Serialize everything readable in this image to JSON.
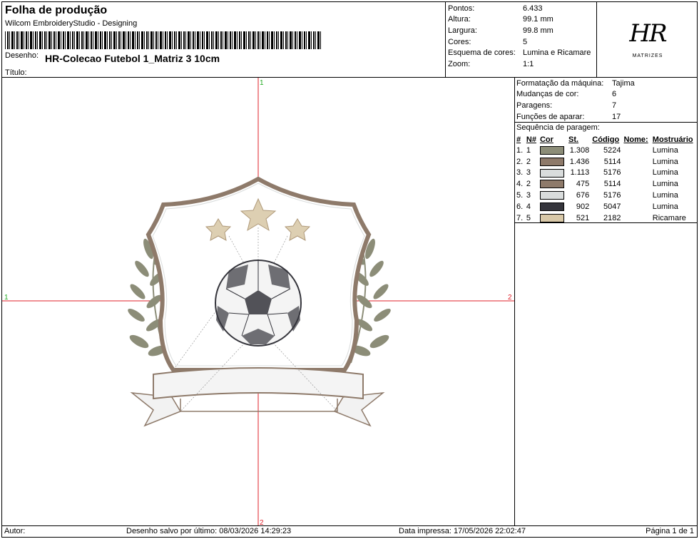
{
  "header": {
    "title": "Folha de produção",
    "subtitle": "Wilcom EmbroideryStudio - Designing",
    "design_label": "Desenho:",
    "design_value": "HR-Colecao Futebol 1_Matriz 3 10cm",
    "title_label": "Título:"
  },
  "stats": [
    {
      "label": "Pontos:",
      "value": "6.433"
    },
    {
      "label": "Altura:",
      "value": "99.1 mm"
    },
    {
      "label": "Largura:",
      "value": "99.8 mm"
    },
    {
      "label": "Cores:",
      "value": "5"
    },
    {
      "label": "Esquema de cores:",
      "value": "Lumina e Ricamare"
    },
    {
      "label": "Zoom:",
      "value": "1:1"
    }
  ],
  "logo": {
    "mark": "HR",
    "text": "MATRIZES"
  },
  "machine": [
    {
      "label": "Formatação da máquina:",
      "value": "Tajima"
    },
    {
      "label": "Mudanças de cor:",
      "value": "6"
    },
    {
      "label": "Paragens:",
      "value": "7"
    },
    {
      "label": "Funções de aparar:",
      "value": "17"
    }
  ],
  "sequence": {
    "title": "Sequência de paragem:",
    "headers": [
      "#",
      "N#",
      "Cor",
      "St.",
      "Código",
      "Nome:",
      "Mostruário"
    ],
    "rows": [
      {
        "idx": "1.",
        "n": "1",
        "color": "#8c8d78",
        "st": "1.308",
        "code": "5224",
        "name": "",
        "chart": "Lumina"
      },
      {
        "idx": "2.",
        "n": "2",
        "color": "#8e7a6a",
        "st": "1.436",
        "code": "5114",
        "name": "",
        "chart": "Lumina"
      },
      {
        "idx": "3.",
        "n": "3",
        "color": "#d9dcdc",
        "st": "1.113",
        "code": "5176",
        "name": "",
        "chart": "Lumina"
      },
      {
        "idx": "4.",
        "n": "2",
        "color": "#8e7a6a",
        "st": "475",
        "code": "5114",
        "name": "",
        "chart": "Lumina"
      },
      {
        "idx": "5.",
        "n": "3",
        "color": "#d9dcdc",
        "st": "676",
        "code": "5176",
        "name": "",
        "chart": "Lumina"
      },
      {
        "idx": "6.",
        "n": "4",
        "color": "#35353c",
        "st": "902",
        "code": "5047",
        "name": "",
        "chart": "Lumina"
      },
      {
        "idx": "7.",
        "n": "5",
        "color": "#d8c8a8",
        "st": "521",
        "code": "2182",
        "name": "",
        "chart": "Ricamare"
      }
    ]
  },
  "canvas": {
    "marker_top": "1",
    "marker_bottom": "2",
    "marker_left": "1",
    "marker_right": "2",
    "crosshair_color": "#e0202a",
    "marker_color_1": "#22aa22",
    "marker_color_2": "#e0202a"
  },
  "footer": {
    "author": "Autor:",
    "saved": "Desenho salvo por último: 08/03/2026 14:29:23",
    "printed": "Data impressa: 17/05/2026 22:02:47",
    "page": "Página 1 de 1"
  }
}
